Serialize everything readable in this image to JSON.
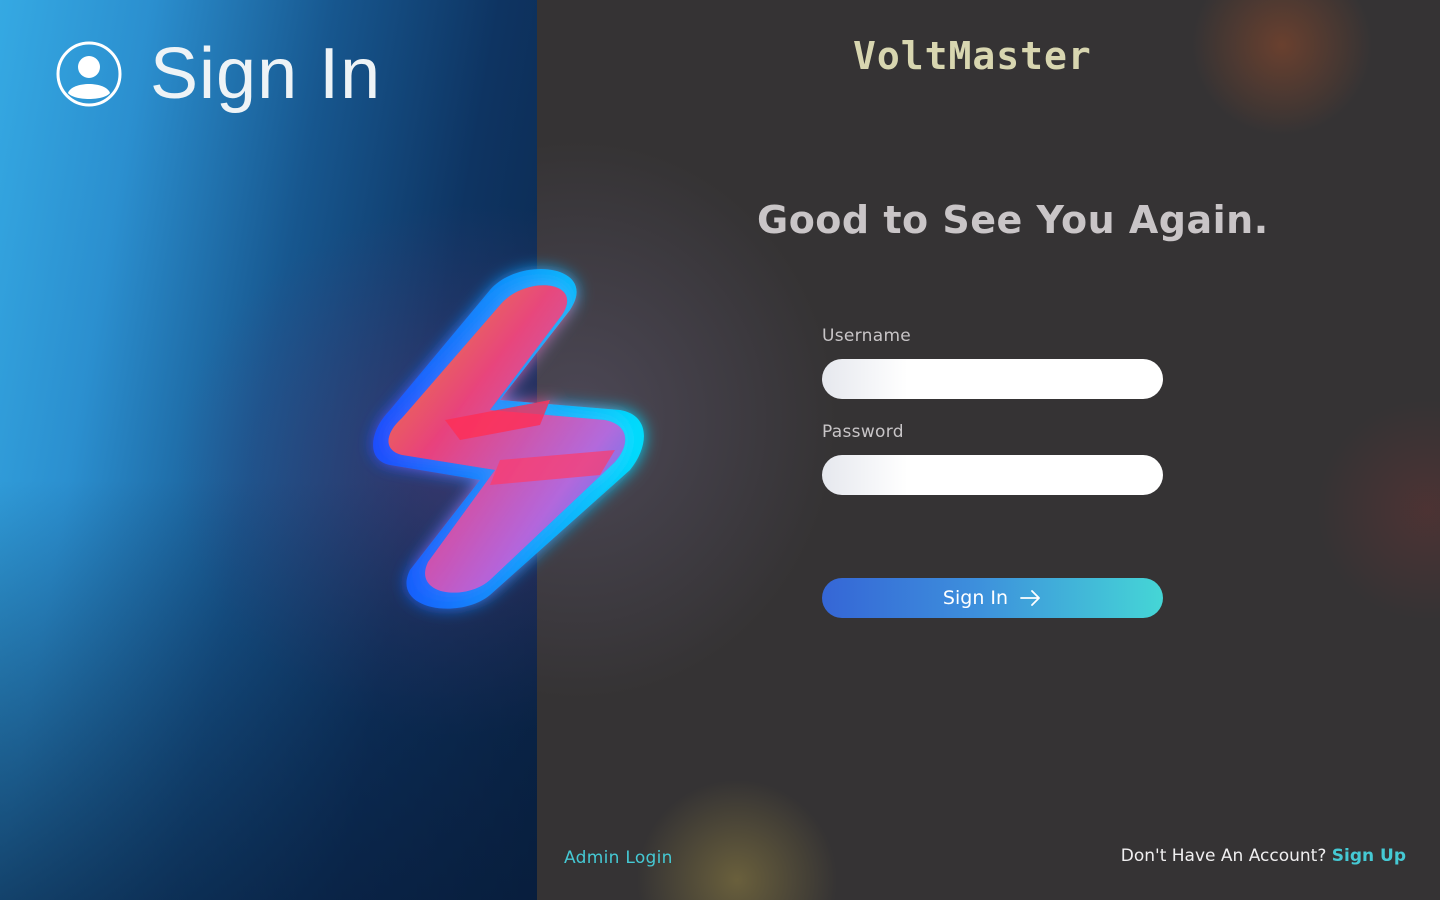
{
  "header": {
    "title": "Sign In",
    "icon": "user-circle-icon"
  },
  "brand": {
    "name": "VoltMaster",
    "logo_icon": "lightning-bolt-icon"
  },
  "form": {
    "greeting": "Good to See You Again.",
    "username_label": "Username",
    "username_value": "",
    "password_label": "Password",
    "password_value": "",
    "submit_label": "Sign In",
    "submit_icon": "arrow-right-icon"
  },
  "footer": {
    "admin_link": "Admin Login",
    "signup_prompt": "Don't Have An Account?",
    "signup_link": "Sign Up"
  },
  "colors": {
    "accent": "#45c9d4",
    "button_start": "#3566d6",
    "button_end": "#45d6d6",
    "brand_text": "#d8d6b0"
  }
}
